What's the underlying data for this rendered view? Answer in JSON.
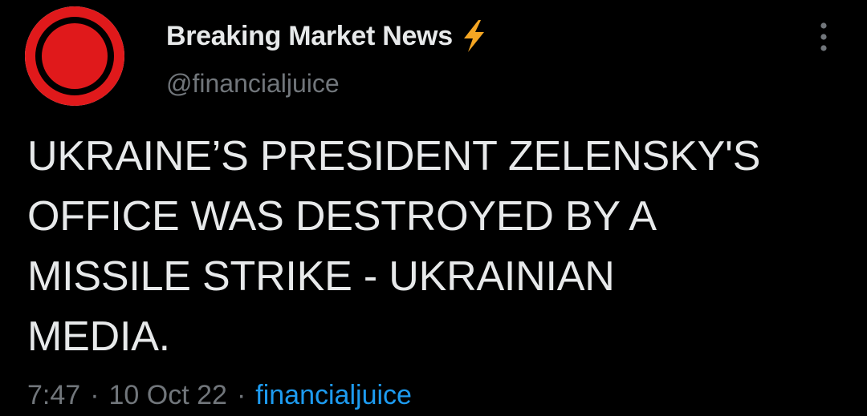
{
  "author": {
    "display_name": "Breaking Market News",
    "handle": "@financialjuice",
    "avatar_icon": "red-circle-record-icon",
    "badge_icon": "lightning-bolt-icon",
    "colors": {
      "avatar_red": "#e0191b",
      "bolt": "#f5a623"
    }
  },
  "tweet": {
    "text": "UKRAINE’S PRESIDENT ZELENSKY'S\nOFFICE WAS DESTROYED BY A\nMISSILE STRIKE - UKRAINIAN\nMEDIA."
  },
  "meta": {
    "time": "7:47",
    "separator": "·",
    "date": "10 Oct 22",
    "source": "financialjuice"
  },
  "menu": {
    "icon": "more-vertical-icon"
  },
  "theme": {
    "background": "#000000",
    "text": "#e7e9ea",
    "muted": "#71767b",
    "link": "#1d9bf0"
  }
}
